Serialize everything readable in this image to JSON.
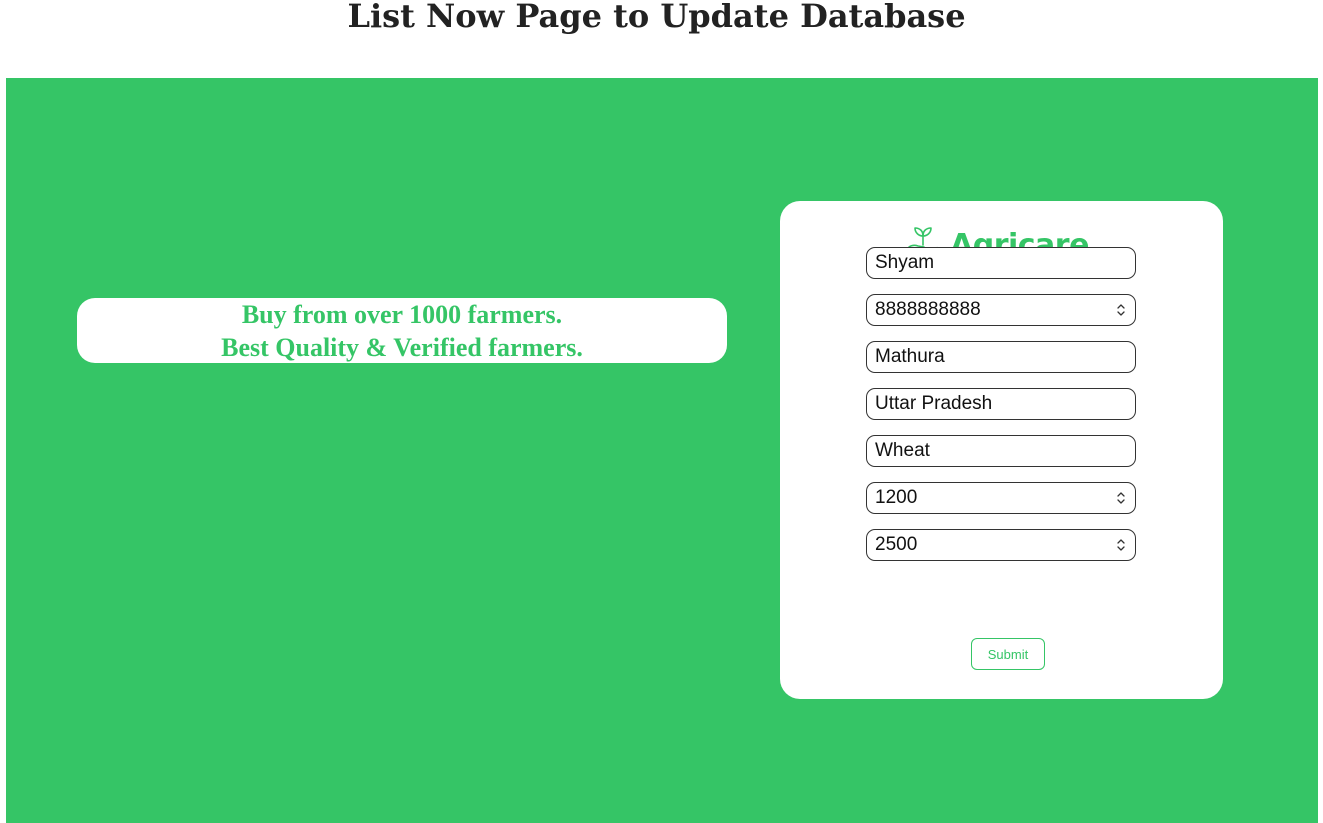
{
  "page": {
    "title": "List Now Page to Update Database"
  },
  "tagline": {
    "line1": "Buy from over 1000 farmers.",
    "line2": "Best Quality & Verified farmers."
  },
  "brand": {
    "name": "Agricare",
    "icon": "sprout-hand-icon",
    "color": "#35c566"
  },
  "form": {
    "fields": [
      {
        "value": "Shyam",
        "type": "text"
      },
      {
        "value": "8888888888",
        "type": "number"
      },
      {
        "value": "Mathura",
        "type": "text"
      },
      {
        "value": "Uttar Pradesh",
        "type": "text"
      },
      {
        "value": "Wheat",
        "type": "text"
      },
      {
        "value": "1200",
        "type": "number"
      },
      {
        "value": "2500",
        "type": "number"
      }
    ],
    "submit_label": "Submit"
  },
  "colors": {
    "accent": "#35c566",
    "background": "#35c566",
    "card": "#ffffff"
  }
}
